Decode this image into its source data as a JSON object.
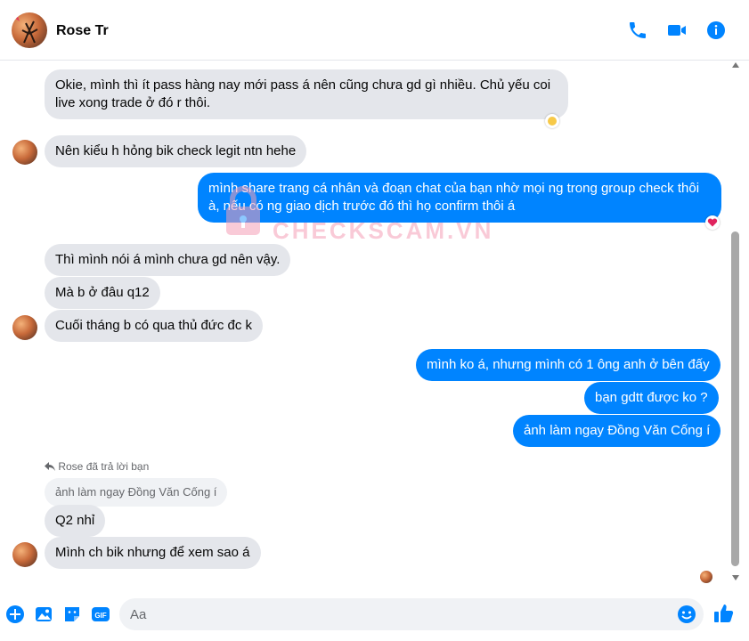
{
  "header": {
    "contact_name": "Rose Tr",
    "icons": [
      "phone-icon",
      "video-icon",
      "info-icon"
    ]
  },
  "messages": [
    {
      "from": "them",
      "text_1": "Okie, mình thì ít pass hàng nay mới pass á nên cũng chưa gd gì nhiều. Chủ yếu coi",
      "text_2": "live xong trade ở đó r thôi.",
      "reaction": "yellow-react"
    },
    {
      "from": "them",
      "text": "Nên kiểu h hỏng bik check legit ntn hehe"
    },
    {
      "from": "me",
      "text_1": "mình share trang cá nhân và đoạn chat của bạn nhờ mọi ng trong group check thôi",
      "text_2": "à, nếu có ng giao dịch trước đó thì họ confirm thôi á",
      "reaction": "heart-react"
    },
    {
      "from": "them",
      "text": "Thì mình nói á mình chưa gd nên vậy."
    },
    {
      "from": "them",
      "text": "Mà b ở đâu q12"
    },
    {
      "from": "them",
      "text": "Cuối tháng b có qua thủ đức đc k"
    },
    {
      "from": "me",
      "text": "mình ko á, nhưng mình có 1 ông anh ở bên đấy"
    },
    {
      "from": "me",
      "text": "bạn gdtt được ko ?"
    },
    {
      "from": "me",
      "text": "ảnh làm ngay Đồng Văn Cống í"
    },
    {
      "from": "them",
      "text": "Q2 nhỉ"
    },
    {
      "from": "them",
      "text": "Mình ch bik nhưng để xem sao á"
    }
  ],
  "reply": {
    "label": "Rose đã trả lời bạn",
    "quote": "ảnh làm ngay Đồng Văn Cống í"
  },
  "watermark": {
    "text": "CHECKSCAM.VN"
  },
  "composer": {
    "placeholder": "Aa",
    "value": ""
  },
  "colors": {
    "accent": "#0084ff",
    "incoming_bubble": "#e4e6eb",
    "outgoing_text": "#ffffff"
  }
}
